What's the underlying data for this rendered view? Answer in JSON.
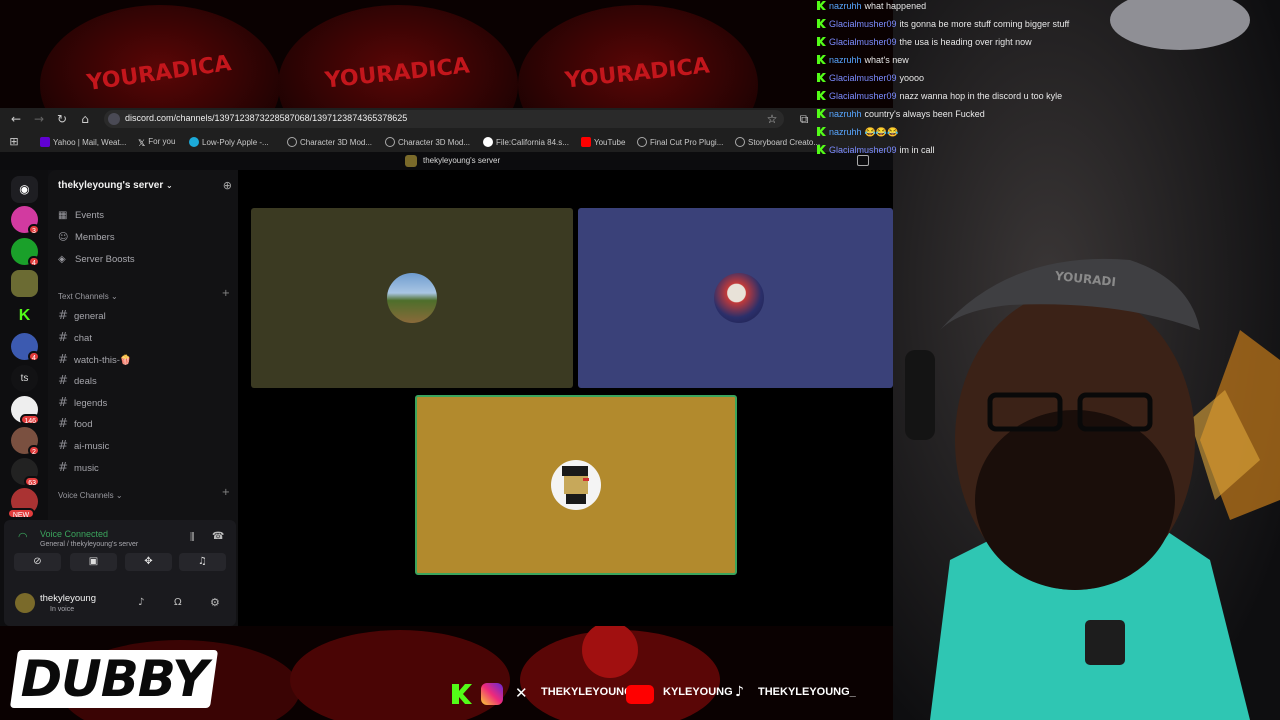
{
  "stream_background": {
    "hat_text": "YOURADICA",
    "cam_hat_text": "YOURADI"
  },
  "browser": {
    "url": "discord.com/channels/1397123873228587068/1397123874365378625",
    "bookmarks": [
      {
        "label": "Yahoo | Mail, Weat...",
        "icon": "yahoo-icon",
        "color": "#6001d2"
      },
      {
        "label": "For you",
        "icon": "x-icon",
        "color": "#000000"
      },
      {
        "label": "Low-Poly Apple -...",
        "icon": "sketchfab-icon",
        "color": "#1caad9"
      },
      {
        "label": "Character 3D Mod...",
        "icon": "globe-icon",
        "color": "#888888"
      },
      {
        "label": "Character 3D Mod...",
        "icon": "globe-icon",
        "color": "#888888"
      },
      {
        "label": "File:California 84.s...",
        "icon": "wiki-icon",
        "color": "#ffffff"
      },
      {
        "label": "YouTube",
        "icon": "youtube-icon",
        "color": "#ff0000"
      },
      {
        "label": "Final Cut Pro Plugi...",
        "icon": "globe-icon",
        "color": "#888888"
      },
      {
        "label": "Storyboard Creato...",
        "icon": "globe-icon",
        "color": "#888888"
      }
    ]
  },
  "discord": {
    "window_title": "thekyleyoung's server",
    "server_name": "thekyleyoung's server",
    "server_badges": [
      "3",
      "4",
      "",
      "",
      "4",
      "",
      "146",
      "2",
      "63",
      "NEW"
    ],
    "rail_text_server": "ts",
    "menu": [
      {
        "label": "Events",
        "icon": "calendar-icon"
      },
      {
        "label": "Members",
        "icon": "members-icon"
      },
      {
        "label": "Server Boosts",
        "icon": "boost-icon"
      }
    ],
    "text_category": "Text Channels",
    "text_channels": [
      "general",
      "chat",
      "watch-this-🍿",
      "deals",
      "legends",
      "food",
      "ai-music",
      "music"
    ],
    "voice_category": "Voice Channels",
    "voice_status": "Voice Connected",
    "voice_location": "General / thekyleyoung's server",
    "user_name": "thekyleyoung",
    "user_status": "In voice",
    "tiles": [
      {
        "color": "#3b3a22",
        "avatar": "landscape-avatar"
      },
      {
        "color": "#3a4179",
        "avatar": "anime-avatar"
      },
      {
        "color": "#b28a2d",
        "avatar": "pixel-avatar",
        "speaking": true,
        "ring": "#3ba55d"
      }
    ]
  },
  "chat": [
    {
      "user": "nazruhh",
      "text": "what happened",
      "kind": "n"
    },
    {
      "user": "Glacialmusher09",
      "text": "its gonna be more stuff coming bigger stuff",
      "kind": "g"
    },
    {
      "user": "Glacialmusher09",
      "text": "the usa is heading over right now",
      "kind": "g"
    },
    {
      "user": "nazruhh",
      "text": "what's new",
      "kind": "n"
    },
    {
      "user": "Glacialmusher09",
      "text": "yoooo",
      "kind": "g"
    },
    {
      "user": "Glacialmusher09",
      "text": "nazz wanna hop in the discord u too kyle",
      "kind": "g"
    },
    {
      "user": "nazruhh",
      "text": "country's always been Fucked",
      "kind": "n"
    },
    {
      "user": "nazruhh",
      "text": "😂😂😂",
      "kind": "n"
    },
    {
      "user": "Glacialmusher09",
      "text": "im in call",
      "kind": "g"
    }
  ],
  "overlay": {
    "logo": "DUBBY",
    "socials": [
      {
        "icon": "kick-icon",
        "label": ""
      },
      {
        "icon": "instagram-icon",
        "label": ""
      },
      {
        "icon": "x-icon",
        "label": "THEKYLEYOUNG"
      },
      {
        "icon": "youtube-icon",
        "label": "KYLEYOUNG"
      },
      {
        "icon": "tiktok-icon",
        "label": "THEKYLEYOUNG_"
      }
    ]
  }
}
